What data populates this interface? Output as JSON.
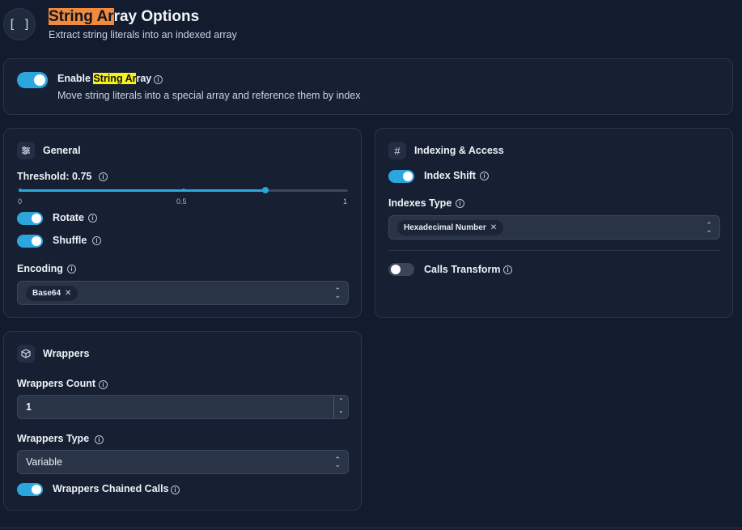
{
  "header": {
    "icon": "brackets-icon",
    "icon_glyph": "[ ]",
    "title_highlight": "String Ar",
    "title_rest": "ray Options",
    "subtitle": "Extract string literals into an indexed array"
  },
  "enable": {
    "label_prefix": "Enable ",
    "label_highlight": "String Ar",
    "label_rest": "ray",
    "description": "Move string literals into a special array and reference them by index",
    "enabled": true
  },
  "general": {
    "title": "General",
    "icon": "sliders-icon",
    "threshold_label": "Threshold: 0.75",
    "threshold_value": 0.75,
    "tick_min": "0",
    "tick_mid": "0.5",
    "tick_max": "1",
    "rotate_label": "Rotate",
    "rotate_on": true,
    "shuffle_label": "Shuffle",
    "shuffle_on": true,
    "encoding_label": "Encoding",
    "encoding_chip": "Base64"
  },
  "indexing": {
    "title": "Indexing & Access",
    "icon": "hash-icon",
    "index_shift_label": "Index Shift",
    "index_shift_on": true,
    "indexes_type_label": "Indexes Type",
    "indexes_type_chip": "Hexadecimal Number",
    "calls_transform_label": "Calls Transform",
    "calls_transform_on": false
  },
  "wrappers": {
    "title": "Wrappers",
    "icon": "cube-icon",
    "count_label": "Wrappers Count",
    "count_value": "1",
    "type_label": "Wrappers Type",
    "type_value": "Variable",
    "chained_label": "Wrappers Chained Calls",
    "chained_on": true
  },
  "colors": {
    "accent": "#2ba7dd",
    "background": "#131c2e",
    "card": "#172033",
    "title_highlight": "#f08a3c",
    "label_highlight": "#f5f217"
  }
}
